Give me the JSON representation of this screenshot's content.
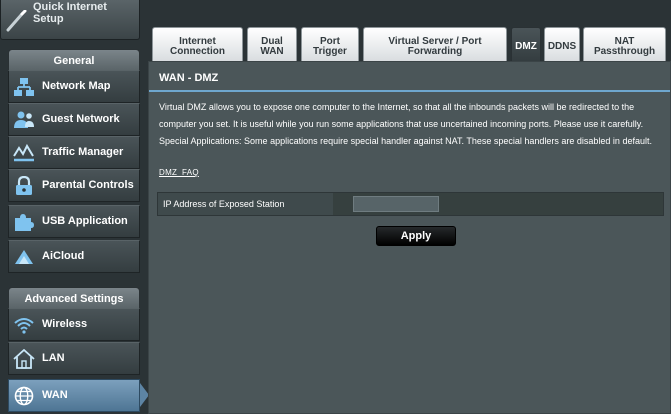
{
  "sidebar": {
    "quick_setup_label": "Quick Internet Setup",
    "general_header": "General",
    "general_items": [
      {
        "label": "Network Map",
        "icon": "network-map-icon"
      },
      {
        "label": "Guest Network",
        "icon": "guest-network-icon"
      },
      {
        "label": "Traffic Manager",
        "icon": "traffic-manager-icon"
      },
      {
        "label": "Parental Controls",
        "icon": "parental-controls-icon"
      },
      {
        "label": "USB Application",
        "icon": "usb-application-icon"
      },
      {
        "label": "AiCloud",
        "icon": "aicloud-icon"
      }
    ],
    "advanced_header": "Advanced Settings",
    "advanced_items": [
      {
        "label": "Wireless",
        "icon": "wireless-icon"
      },
      {
        "label": "LAN",
        "icon": "lan-icon"
      },
      {
        "label": "WAN",
        "icon": "wan-icon",
        "active": true
      }
    ]
  },
  "tabs": [
    {
      "line1": "Internet",
      "line2": "Connection"
    },
    {
      "line1": "Dual",
      "line2": "WAN"
    },
    {
      "line1": "Port",
      "line2": "Trigger"
    },
    {
      "line1": "Virtual Server / Port",
      "line2": "Forwarding"
    },
    {
      "line1": "DMZ",
      "line2": "",
      "active": true
    },
    {
      "line1": "DDNS",
      "line2": ""
    },
    {
      "line1": "NAT",
      "line2": "Passthrough"
    }
  ],
  "page": {
    "title": "WAN - DMZ",
    "description": "Virtual DMZ allows you to expose one computer to the Internet, so that all the inbounds packets will be redirected to the computer you set. It is useful while you run some applications that use uncertained incoming ports. Please use it carefully. Special Applications: Some applications require special handler against NAT. These special handlers are disabled in default.",
    "faq_link": "DMZ_FAQ",
    "field_label": "IP Address of Exposed Station",
    "field_value": "",
    "apply_label": "Apply"
  },
  "colors": {
    "accent": "#6fa7cf",
    "active_menu": "#5d84a4",
    "panel_bg": "#4b5659"
  }
}
